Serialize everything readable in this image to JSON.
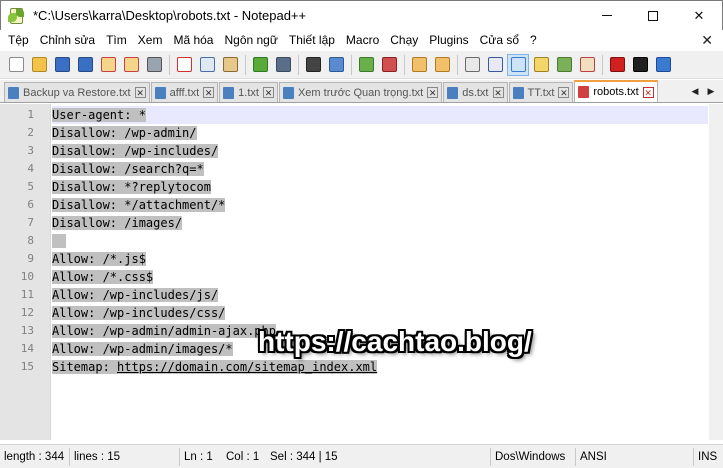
{
  "window": {
    "title": "*C:\\Users\\karra\\Desktop\\robots.txt - Notepad++",
    "minimize_glyph": "",
    "maximize_glyph": "",
    "close_glyph": "✕"
  },
  "menu": {
    "items": [
      "Tệp",
      "Chỉnh sửa",
      "Tìm",
      "Xem",
      "Mã hóa",
      "Ngôn ngữ",
      "Thiết lập",
      "Macro",
      "Chạy",
      "Plugins",
      "Cửa sổ",
      "?"
    ],
    "close_glyph": "✕"
  },
  "toolbar": {
    "icons": [
      {
        "name": "new-file-icon",
        "color": "#ffffff",
        "border": "#8a8a8a"
      },
      {
        "name": "open-file-icon",
        "color": "#f2c24a",
        "border": "#b08a20"
      },
      {
        "name": "save-icon",
        "color": "#3a6fc4",
        "border": "#244a8a"
      },
      {
        "name": "save-all-icon",
        "color": "#3a6fc4",
        "border": "#244a8a"
      },
      {
        "name": "close-file-icon",
        "color": "#f4d58a",
        "border": "#c84040"
      },
      {
        "name": "close-all-icon",
        "color": "#f4d58a",
        "border": "#c84040"
      },
      {
        "name": "print-icon",
        "color": "#9aa4b0",
        "border": "#555"
      },
      {
        "sep": true
      },
      {
        "name": "cut-icon",
        "color": "#ffffff",
        "border": "#d03030"
      },
      {
        "name": "copy-icon",
        "color": "#dfe8f5",
        "border": "#4a6ea8"
      },
      {
        "name": "paste-icon",
        "color": "#e8c88a",
        "border": "#8a6a30"
      },
      {
        "sep": true
      },
      {
        "name": "undo-icon",
        "color": "#5aaa3a",
        "border": "#2e7a1e"
      },
      {
        "name": "redo-icon",
        "color": "#5a6e8a",
        "border": "#3a4a60"
      },
      {
        "sep": true
      },
      {
        "name": "find-icon",
        "color": "#444444",
        "border": "#222"
      },
      {
        "name": "replace-icon",
        "color": "#5a8ad0",
        "border": "#2a5a9a"
      },
      {
        "sep": true
      },
      {
        "name": "zoom-in-icon",
        "color": "#6ab04a",
        "border": "#3a7a2a"
      },
      {
        "name": "zoom-out-icon",
        "color": "#d05050",
        "border": "#902020"
      },
      {
        "sep": true
      },
      {
        "name": "sync-vertical-icon",
        "color": "#f2c06a",
        "border": "#b07a20"
      },
      {
        "name": "sync-horizontal-icon",
        "color": "#f2c06a",
        "border": "#b07a20"
      },
      {
        "sep": true
      },
      {
        "name": "word-wrap-icon",
        "color": "#e8e8e8",
        "border": "#6a6a6a"
      },
      {
        "name": "show-all-chars-icon",
        "color": "#e8e8f8",
        "border": "#3a5aa0"
      },
      {
        "name": "indent-guide-icon",
        "color": "#cde4f7",
        "border": "#3a7ad0",
        "active": true
      },
      {
        "name": "udl-icon",
        "color": "#f2d66a",
        "border": "#a08020"
      },
      {
        "name": "doc-map-icon",
        "color": "#7ab05a",
        "border": "#4a7a2a"
      },
      {
        "name": "function-list-icon",
        "color": "#f0e0c0",
        "border": "#c04040"
      },
      {
        "sep": true
      },
      {
        "name": "record-macro-icon",
        "color": "#d02020",
        "border": "#801010"
      },
      {
        "name": "stop-record-icon",
        "color": "#202020",
        "border": "#000"
      },
      {
        "name": "play-macro-icon",
        "color": "#3a7ad0",
        "border": "#1a4a9a"
      }
    ]
  },
  "tabs": [
    {
      "label": "Backup va Restore.txt",
      "active": false
    },
    {
      "label": "afff.txt",
      "active": false
    },
    {
      "label": "1.txt",
      "active": false
    },
    {
      "label": "Xem trước Quan trọng.txt",
      "active": false
    },
    {
      "label": "ds.txt",
      "active": false
    },
    {
      "label": "TT.txt",
      "active": false
    },
    {
      "label": "robots.txt",
      "active": true
    }
  ],
  "tab_scroll": {
    "left": "◀",
    "right": "▶"
  },
  "editor": {
    "lines": [
      {
        "n": "1",
        "text": "User-agent: *"
      },
      {
        "n": "2",
        "text": "Disallow: /wp-admin/"
      },
      {
        "n": "3",
        "text": "Disallow: /wp-includes/"
      },
      {
        "n": "4",
        "text": "Disallow: /search?q=*"
      },
      {
        "n": "5",
        "text": "Disallow: *?replytocom"
      },
      {
        "n": "6",
        "text": "Disallow: */attachment/*"
      },
      {
        "n": "7",
        "text": "Disallow: /images/"
      },
      {
        "n": "8",
        "text": ""
      },
      {
        "n": "9",
        "text": "Allow: /*.js$"
      },
      {
        "n": "10",
        "text": "Allow: /*.css$"
      },
      {
        "n": "11",
        "text": "Allow: /wp-includes/js/"
      },
      {
        "n": "12",
        "text": "Allow: /wp-includes/css/"
      },
      {
        "n": "13",
        "text": "Allow: /wp-admin/admin-ajax.php"
      },
      {
        "n": "14",
        "text": "Allow: /wp-admin/images/*"
      },
      {
        "n": "15",
        "text": "Sitemap: ",
        "url": "https://domain.com/sitemap_index.xml"
      }
    ],
    "watermark": "https://cachtao.blog/"
  },
  "status": {
    "length": "length : 344",
    "lines": "lines : 15",
    "ln": "Ln : 1",
    "col": "Col : 1",
    "sel": "Sel : 344 | 15",
    "eol": "Dos\\Windows",
    "encoding": "ANSI",
    "mode": "INS"
  }
}
